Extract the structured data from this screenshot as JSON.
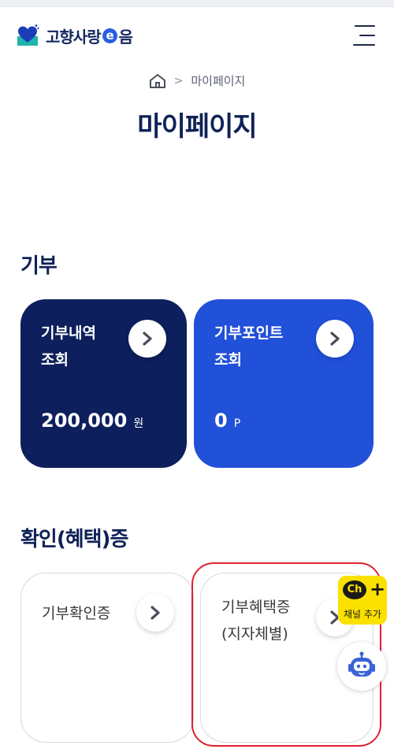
{
  "header": {
    "logo_text_1": "고향사랑",
    "logo_e": "e",
    "logo_text_2": "음"
  },
  "breadcrumb": {
    "current": "마이페이지",
    "separator": ">"
  },
  "page_title": "마이페이지",
  "donation": {
    "title": "기부",
    "history": {
      "label": "기부내역\n조회",
      "value": "200,000",
      "unit": "원"
    },
    "points": {
      "label": "기부포인트\n조회",
      "value": "0",
      "unit": "P"
    }
  },
  "certificates": {
    "title": "확인(혜택)증",
    "confirmation": {
      "label": "기부확인증"
    },
    "benefit": {
      "label": "기부혜택증\n(지자체별)"
    }
  },
  "floating": {
    "kakao_ch": "Ch",
    "kakao_plus": "+",
    "kakao_label": "채널 추가"
  },
  "colors": {
    "dark_card": "#0d1f5c",
    "blue_card": "#2150d9",
    "highlight": "#e02030",
    "kakao": "#fae100"
  }
}
